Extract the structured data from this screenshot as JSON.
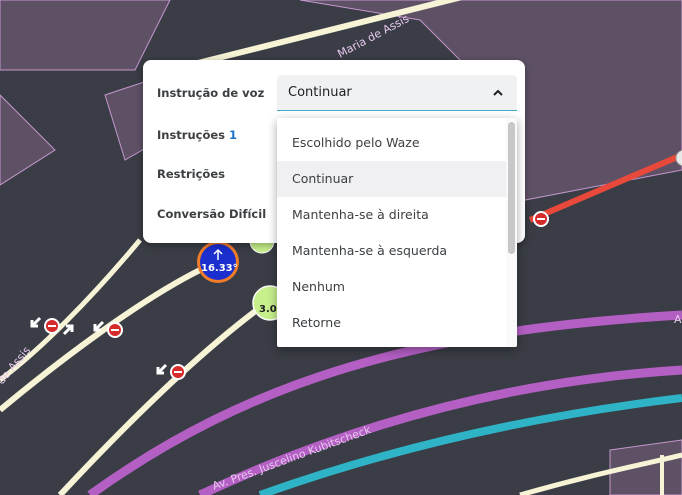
{
  "map": {
    "streets": {
      "top_diagonal": "Maria de Assis",
      "left_diagonal": "de Assis",
      "bottom_avenue": "Av. Pres. Juscelino Kubitscheck",
      "right_edge": "A"
    },
    "angle_badge": "16.33°",
    "speed_marker_1": "3.0",
    "colors": {
      "background": "#3a3d45",
      "building_fill": "#5e5165",
      "building_stroke": "#c497ce",
      "primary_street": "#b45fc4",
      "freeway": "#2fb3c6",
      "minor_street": "#f6f3d6",
      "red_street": "#e8493a",
      "badge_blue": "#1b2fcf",
      "badge_ring": "#f07d2a",
      "speed_green": "#c7f08c"
    }
  },
  "panel": {
    "voice_label": "Instrução de voz",
    "instructions_label": "Instruções",
    "instructions_count": "1",
    "restrictions_label": "Restrições",
    "difficult_label": "Conversão Difícil",
    "select_value": "Continuar"
  },
  "dropdown": {
    "options": [
      "Escolhido pelo Waze",
      "Continuar",
      "Mantenha-se à direita",
      "Mantenha-se à esquerda",
      "Nenhum",
      "Retorne"
    ],
    "selected_index": 1
  }
}
